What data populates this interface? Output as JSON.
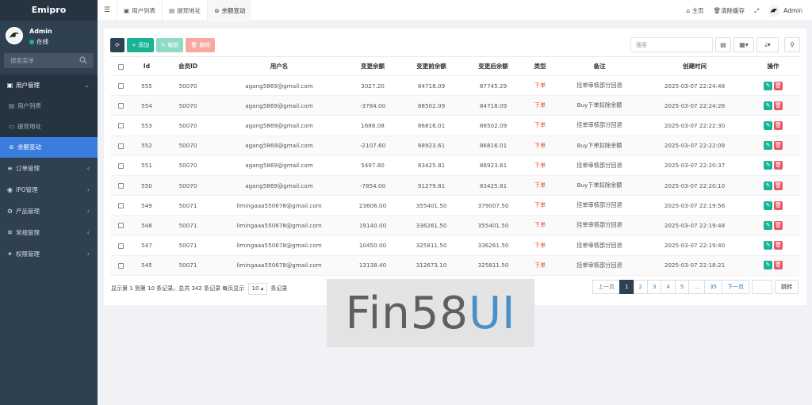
{
  "app": {
    "brand": "Emipro"
  },
  "user": {
    "name": "Admin",
    "status": "在线"
  },
  "sidebar": {
    "search_placeholder": "搜索菜单",
    "items": [
      {
        "label": "用户管理",
        "icon": "user-icon",
        "open": true,
        "children": [
          {
            "label": "用户列表",
            "icon": "list-icon"
          },
          {
            "label": "提现地址",
            "icon": "card-icon"
          },
          {
            "label": "余额变动",
            "icon": "balance-icon",
            "active": true
          }
        ]
      },
      {
        "label": "订单管理",
        "icon": "order-icon"
      },
      {
        "label": "IPO管理",
        "icon": "eye-icon"
      },
      {
        "label": "产品管理",
        "icon": "gear-icon"
      },
      {
        "label": "常规管理",
        "icon": "cog-icon"
      },
      {
        "label": "权限管理",
        "icon": "group-icon"
      }
    ]
  },
  "topbar": {
    "tabs": [
      {
        "label": "用户列表"
      },
      {
        "label": "提现地址"
      },
      {
        "label": "余额变动",
        "active": true
      }
    ],
    "home": "主页",
    "clear_cache": "清除缓存",
    "user": "Admin"
  },
  "toolbar": {
    "add": "添加",
    "edit": "编辑",
    "delete": "删除",
    "search_placeholder": "搜索"
  },
  "table": {
    "headers": [
      "Id",
      "会员ID",
      "用户名",
      "变更余额",
      "变更前余额",
      "变更后余额",
      "类型",
      "备注",
      "创建时间",
      "操作"
    ],
    "rows": [
      {
        "id": "555",
        "member": "50070",
        "username": "agang5869@gmail.com",
        "change": "3027.20",
        "before": "84718.09",
        "after": "87745.29",
        "type": "下单",
        "note": "挂单审核部分回退",
        "time": "2025-03-07 22:24:48"
      },
      {
        "id": "554",
        "member": "50070",
        "username": "agang5869@gmail.com",
        "change": "-3784.00",
        "before": "88502.09",
        "after": "84718.09",
        "type": "下单",
        "note": "Buy下单扣除余额",
        "time": "2025-03-07 22:24:26"
      },
      {
        "id": "553",
        "member": "50070",
        "username": "agang5869@gmail.com",
        "change": "1686.08",
        "before": "86816.01",
        "after": "88502.09",
        "type": "下单",
        "note": "挂单审核部分回退",
        "time": "2025-03-07 22:22:30"
      },
      {
        "id": "552",
        "member": "50070",
        "username": "agang5869@gmail.com",
        "change": "-2107.60",
        "before": "88923.61",
        "after": "86816.01",
        "type": "下单",
        "note": "Buy下单扣除余额",
        "time": "2025-03-07 22:22:09"
      },
      {
        "id": "551",
        "member": "50070",
        "username": "agang5869@gmail.com",
        "change": "5497.80",
        "before": "83425.81",
        "after": "88923.61",
        "type": "下单",
        "note": "挂单审核部分回退",
        "time": "2025-03-07 22:20:37"
      },
      {
        "id": "550",
        "member": "50070",
        "username": "agang5869@gmail.com",
        "change": "-7854.00",
        "before": "91279.81",
        "after": "83425.81",
        "type": "下单",
        "note": "Buy下单扣除余额",
        "time": "2025-03-07 22:20:10"
      },
      {
        "id": "549",
        "member": "50071",
        "username": "limingaaa550678@gmail.com",
        "change": "23606.00",
        "before": "355401.50",
        "after": "379007.50",
        "type": "下单",
        "note": "挂单审核部分回退",
        "time": "2025-03-07 22:19:56"
      },
      {
        "id": "548",
        "member": "50071",
        "username": "limingaaa550678@gmail.com",
        "change": "19140.00",
        "before": "336261.50",
        "after": "355401.50",
        "type": "下单",
        "note": "挂单审核部分回退",
        "time": "2025-03-07 22:19:48"
      },
      {
        "id": "547",
        "member": "50071",
        "username": "limingaaa550678@gmail.com",
        "change": "10450.00",
        "before": "325811.50",
        "after": "336261.50",
        "type": "下单",
        "note": "挂单审核部分回退",
        "time": "2025-03-07 22:19:40"
      },
      {
        "id": "545",
        "member": "50071",
        "username": "limingaaa550678@gmail.com",
        "change": "13138.40",
        "before": "312673.10",
        "after": "325811.50",
        "type": "下单",
        "note": "挂单审核部分回退",
        "time": "2025-03-07 22:18:21"
      }
    ]
  },
  "footer": {
    "info_prefix": "显示第 1 到第 10 条记录，总共 342 条记录 每页显示",
    "page_size": "10",
    "info_suffix": "条记录",
    "pager": {
      "prev": "上一页",
      "pages": [
        "1",
        "2",
        "3",
        "4",
        "5",
        "...",
        "35"
      ],
      "next": "下一页",
      "jump": "跳转"
    }
  },
  "watermark": {
    "part1": "Fin58",
    "part2": "UI"
  }
}
